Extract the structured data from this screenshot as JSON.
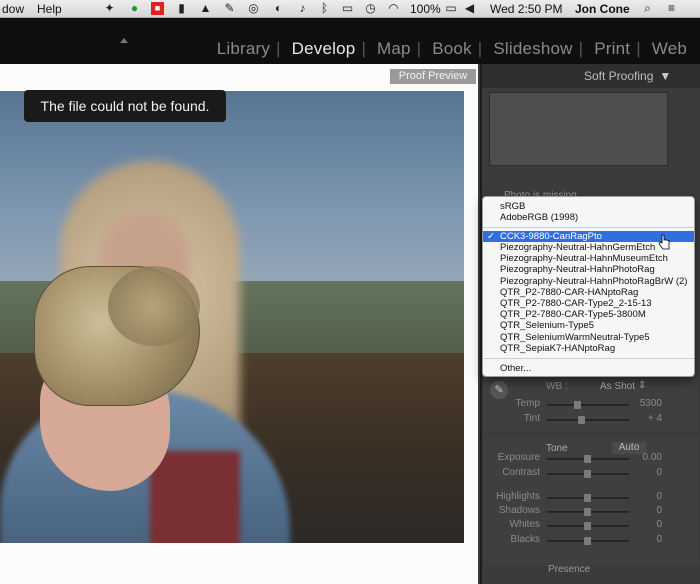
{
  "menubar": {
    "items": [
      "dow",
      "Help"
    ],
    "battery": "100%",
    "clock": "Wed 2:50 PM",
    "user": "Jon Cone"
  },
  "modules": [
    "Library",
    "Develop",
    "Map",
    "Book",
    "Slideshow",
    "Print",
    "Web"
  ],
  "active_module": "Develop",
  "canvas": {
    "proof_preview_label": "Proof Preview",
    "toast": "The file could not be found."
  },
  "right_panel": {
    "soft_proofing_title": "Soft Proofing",
    "photo_missing": "Photo is missing",
    "wb_label": "WB :",
    "wb_value": "As Shot",
    "tone_label": "Tone",
    "auto_label": "Auto",
    "presence_label": "Presence",
    "sliders": [
      {
        "label": "Temp",
        "value": "5300"
      },
      {
        "label": "Tint",
        "value": "+ 4"
      },
      {
        "label": "Exposure",
        "value": "0.00"
      },
      {
        "label": "Contrast",
        "value": "0"
      },
      {
        "label": "Highlights",
        "value": "0"
      },
      {
        "label": "Shadows",
        "value": "0"
      },
      {
        "label": "Whites",
        "value": "0"
      },
      {
        "label": "Blacks",
        "value": "0"
      }
    ]
  },
  "profile_menu": {
    "group1": [
      "sRGB",
      "AdobeRGB (1998)"
    ],
    "selected": "CCK3-9880-CanRagPto",
    "group2": [
      "Piezography-Neutral-HahnGermEtch",
      "Piezography-Neutral-HahnMuseumEtch",
      "Piezography-Neutral-HahnPhotoRag",
      "Piezography-Neutral-HahnPhotoRagBrW (2)",
      "QTR_P2-7880-CAR-HANptoRag",
      "QTR_P2-7880-CAR-Type2_2-15-13",
      "QTR_P2-7880-CAR-Type5-3800M",
      "QTR_Selenium-Type5",
      "QTR_SeleniumWarmNeutral-Type5",
      "QTR_SepiaK7-HANptoRag"
    ],
    "other": "Other..."
  },
  "colors": {
    "selection": "#2f6fe0",
    "module_active": "#e8e8e8",
    "module_inactive": "#8a8a8a"
  }
}
